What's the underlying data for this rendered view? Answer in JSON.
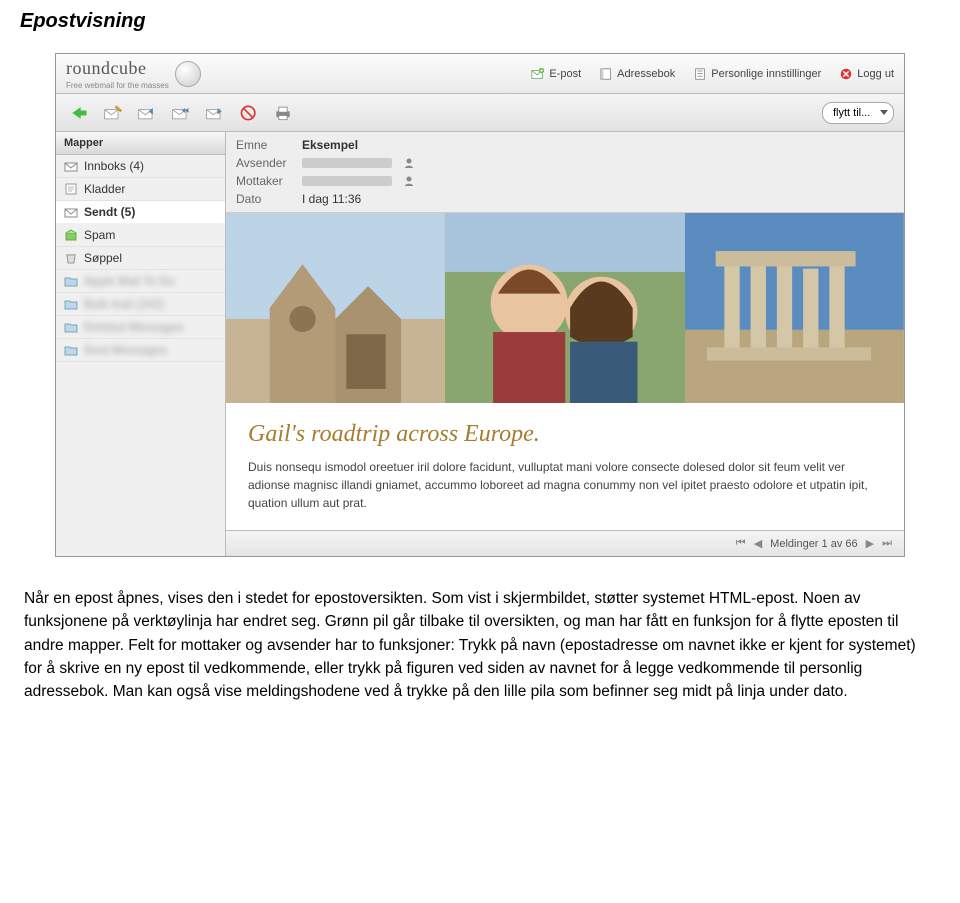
{
  "doc": {
    "title": "Epostvisning",
    "paragraph": "Når en epost åpnes, vises den i stedet for epostoversikten. Som vist i skjermbildet, støtter systemet HTML-epost. Noen av funksjonene på verktøylinja har endret seg. Grønn pil går tilbake til oversikten, og man har fått en funksjon for å flytte eposten til andre mapper. Felt for mottaker og avsender har to funksjoner: Trykk på navn (epostadresse om navnet ikke er kjent for systemet) for å skrive en ny epost til vedkommende, eller trykk på figuren ved siden av navnet for å legge vedkommende til personlig adressebok. Man kan også vise meldingshodene ved å trykke på den lille pila som befinner seg midt på linja under dato."
  },
  "screenshot": {
    "brand": {
      "name": "roundcube",
      "tagline": "Free webmail for the masses"
    },
    "topnav": {
      "mail": "E-post",
      "addressbook": "Adressebok",
      "settings": "Personlige innstillinger",
      "logout": "Logg ut"
    },
    "toolbar": {
      "move_placeholder": "flytt til..."
    },
    "sidebar": {
      "header": "Mapper",
      "items": [
        {
          "label": "Innboks (4)",
          "icon": "inbox"
        },
        {
          "label": "Kladder",
          "icon": "draft"
        },
        {
          "label": "Sendt (5)",
          "icon": "sent"
        },
        {
          "label": "Spam",
          "icon": "spam"
        },
        {
          "label": "Søppel",
          "icon": "trash"
        },
        {
          "label": "Apple Mail To Do",
          "icon": "folder",
          "blur": true
        },
        {
          "label": "Bulk mail (242)",
          "icon": "folder",
          "blur": true
        },
        {
          "label": "Deleted Messages",
          "icon": "folder",
          "blur": true
        },
        {
          "label": "Sent Messages",
          "icon": "folder",
          "blur": true
        }
      ],
      "selected_index": 2
    },
    "message": {
      "subject_label": "Emne",
      "subject_value": "Eksempel",
      "from_label": "Avsender",
      "to_label": "Mottaker",
      "date_label": "Dato",
      "date_value": "I dag 11:36",
      "post_title": "Gail's roadtrip across Europe.",
      "post_body": "Duis nonsequ ismodol oreetuer iril dolore facidunt, vulluptat mani volore consecte dolesed dolor sit feum velit ver adionse magnisc illandi gniamet, accummo loboreet ad magna conummy non vel ipitet praesto odolore et utpatin ipit, quation ullum aut prat."
    },
    "pager": {
      "text": "Meldinger 1 av 66"
    }
  }
}
